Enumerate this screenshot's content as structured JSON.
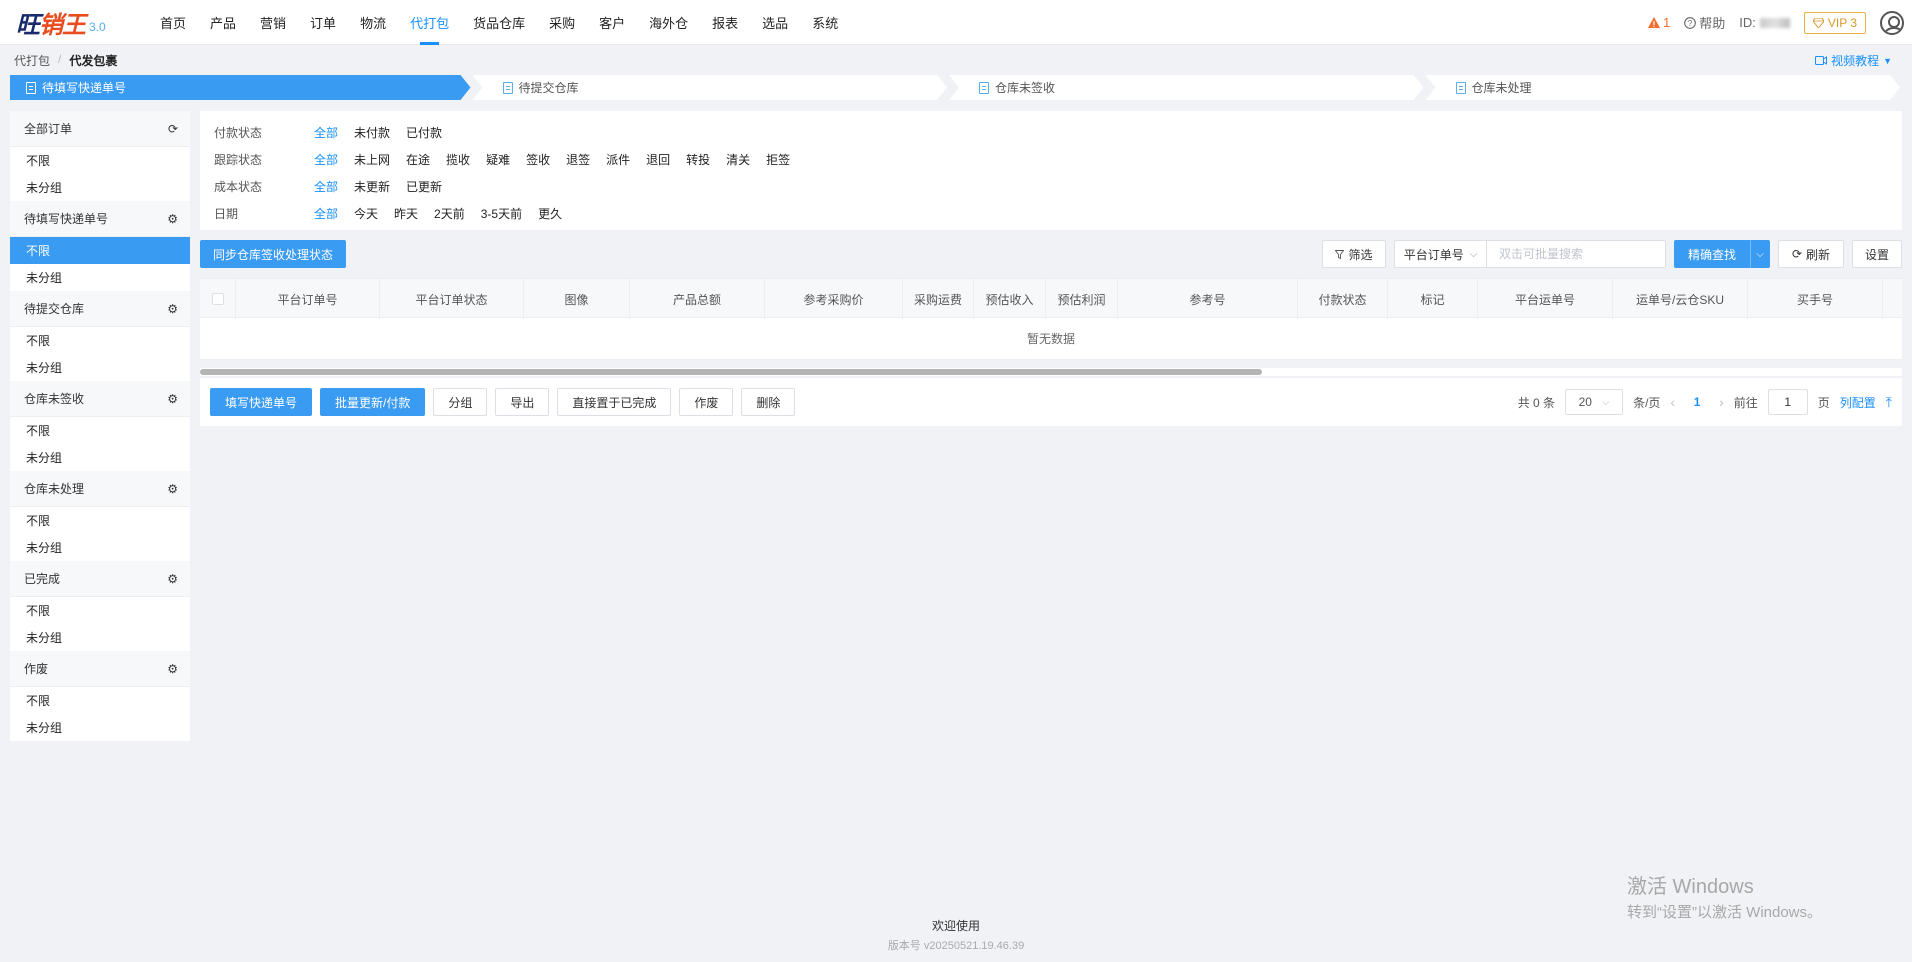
{
  "app": {
    "logo_text_a": "旺",
    "logo_text_b": "销王",
    "version": "3.0"
  },
  "nav": {
    "items": [
      {
        "label": "首页"
      },
      {
        "label": "产品"
      },
      {
        "label": "营销"
      },
      {
        "label": "订单"
      },
      {
        "label": "物流"
      },
      {
        "label": "代打包",
        "active": true
      },
      {
        "label": "货品仓库"
      },
      {
        "label": "采购"
      },
      {
        "label": "客户"
      },
      {
        "label": "海外仓"
      },
      {
        "label": "报表"
      },
      {
        "label": "选品"
      },
      {
        "label": "系统"
      }
    ],
    "alert_count": "1",
    "help_label": "帮助",
    "id_label": "ID:",
    "vip_label": "VIP 3"
  },
  "breadcrumb": {
    "parent": "代打包",
    "separator": "/",
    "current": "代发包裹"
  },
  "video_tutorial": "视频教程",
  "steps": [
    {
      "label": "待填写快递单号",
      "active": true
    },
    {
      "label": "待提交仓库"
    },
    {
      "label": "仓库未签收"
    },
    {
      "label": "仓库未处理"
    }
  ],
  "sidebar": {
    "groups": [
      {
        "title": "全部订单",
        "icon": "refresh-icon",
        "items": [
          "不限",
          "未分组"
        ]
      },
      {
        "title": "待填写快递单号",
        "icon": "gear-icon",
        "items": [
          "不限",
          "未分组"
        ],
        "active_index": 0
      },
      {
        "title": "待提交仓库",
        "icon": "gear-icon",
        "items": [
          "不限",
          "未分组"
        ]
      },
      {
        "title": "仓库未签收",
        "icon": "gear-icon",
        "items": [
          "不限",
          "未分组"
        ]
      },
      {
        "title": "仓库未处理",
        "icon": "gear-icon",
        "items": [
          "不限",
          "未分组"
        ]
      },
      {
        "title": "已完成",
        "icon": "gear-icon",
        "items": [
          "不限",
          "未分组"
        ]
      },
      {
        "title": "作废",
        "icon": "gear-icon",
        "items": [
          "不限",
          "未分组"
        ]
      }
    ]
  },
  "filters": [
    {
      "label": "付款状态",
      "options": [
        "全部",
        "未付款",
        "已付款"
      ]
    },
    {
      "label": "跟踪状态",
      "options": [
        "全部",
        "未上网",
        "在途",
        "揽收",
        "疑难",
        "签收",
        "退签",
        "派件",
        "退回",
        "转投",
        "清关",
        "拒签"
      ]
    },
    {
      "label": "成本状态",
      "options": [
        "全部",
        "未更新",
        "已更新"
      ]
    },
    {
      "label": "日期",
      "options": [
        "全部",
        "今天",
        "昨天",
        "2天前",
        "3-5天前",
        "更久"
      ]
    }
  ],
  "toolbar": {
    "sync_label": "同步仓库签收处理状态",
    "filter_label": "筛选",
    "search_field": "平台订单号",
    "search_placeholder": "双击可批量搜索",
    "precise_label": "精确查找",
    "refresh_label": "刷新",
    "settings_label": "设置"
  },
  "table": {
    "columns": [
      "平台订单号",
      "平台订单状态",
      "图像",
      "产品总额",
      "参考采购价",
      "采购运费",
      "预估收入",
      "预估利润",
      "参考号",
      "付款状态",
      "标记",
      "平台运单号",
      "运单号/云仓SKU",
      "买手号"
    ],
    "empty_text": "暂无数据"
  },
  "actions": {
    "fill_tracking": "填写快递单号",
    "batch_update": "批量更新/付款",
    "group": "分组",
    "export": "导出",
    "set_complete": "直接置于已完成",
    "void": "作废",
    "delete": "删除"
  },
  "pager": {
    "total": "共 0 条",
    "page_size": "20",
    "per_page_label": "条/页",
    "current_page": "1",
    "goto_label": "前往",
    "goto_value": "1",
    "page_unit": "页",
    "column_config": "列配置"
  },
  "footer": {
    "welcome": "欢迎使用",
    "version": "版本号 v20250521.19.46.39"
  },
  "watermark": {
    "line1": "激活 Windows",
    "line2": "转到“设置”以激活 Windows。"
  },
  "colors": {
    "accent": "#3a9bf3",
    "link": "#1890ff",
    "warning": "#f56c2c",
    "vip": "#d99a24"
  }
}
